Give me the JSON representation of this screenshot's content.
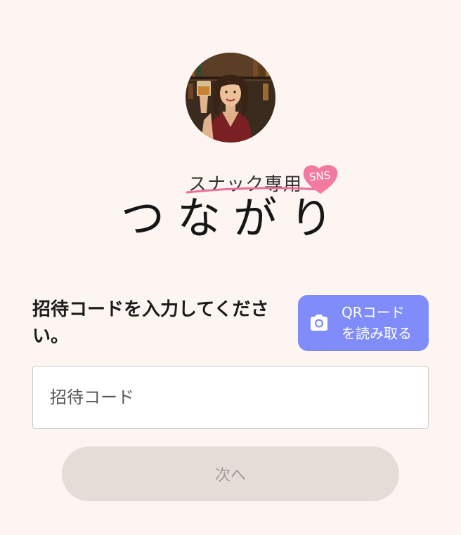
{
  "brand": {
    "subtitle": "スナック専用",
    "badge": "SNS",
    "name": "つながり"
  },
  "avatar": {
    "description_icon": "hostess-avatar"
  },
  "prompt": {
    "text": "招待コードを入力してください。"
  },
  "qr_button": {
    "icon": "camera-icon",
    "line1": "QRコード",
    "line2": "を読み取る"
  },
  "code_input": {
    "value": "",
    "placeholder": "招待コード"
  },
  "next_button": {
    "label": "次へ",
    "enabled": false
  },
  "colors": {
    "background": "#fdf5f1",
    "accent": "#7f8cf9",
    "heart": "#f27a9e",
    "disabled_button": "#e5dcd8",
    "disabled_text": "#a19a98"
  }
}
